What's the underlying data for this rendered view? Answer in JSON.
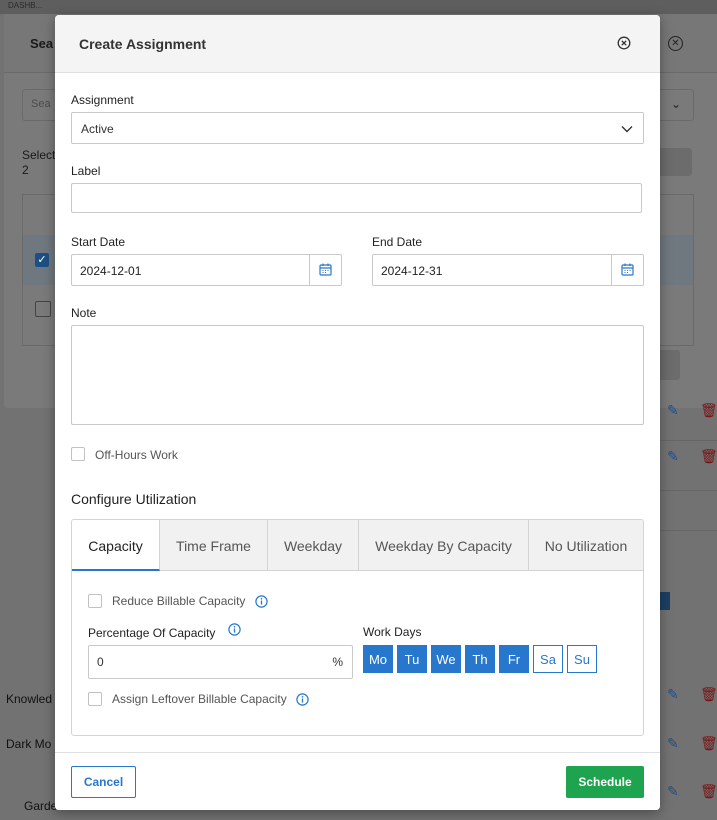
{
  "background": {
    "top_text": "DASHB...",
    "dialog_title": "Sea",
    "search_placeholder": "Sea",
    "selected_label": "Selecte",
    "selected_count": "2",
    "list_items": [
      "Knowled",
      "Dark Mo",
      "Garde"
    ]
  },
  "modal": {
    "title": "Create Assignment",
    "assignment": {
      "label": "Assignment",
      "value": "Active"
    },
    "label_field": {
      "label": "Label",
      "value": ""
    },
    "start_date": {
      "label": "Start Date",
      "value": "2024-12-01"
    },
    "end_date": {
      "label": "End Date",
      "value": "2024-12-31"
    },
    "note": {
      "label": "Note",
      "value": ""
    },
    "off_hours": {
      "label": "Off-Hours Work",
      "checked": false
    },
    "utilization": {
      "title": "Configure Utilization",
      "tabs": [
        "Capacity",
        "Time Frame",
        "Weekday",
        "Weekday By Capacity",
        "No Utilization"
      ],
      "active_tab": "Capacity",
      "reduce_billable": {
        "label": "Reduce Billable Capacity",
        "checked": false
      },
      "percentage": {
        "label": "Percentage Of Capacity",
        "value": "0",
        "unit": "%"
      },
      "work_days": {
        "label": "Work Days",
        "days": [
          {
            "label": "Mo",
            "selected": true
          },
          {
            "label": "Tu",
            "selected": true
          },
          {
            "label": "We",
            "selected": true
          },
          {
            "label": "Th",
            "selected": true
          },
          {
            "label": "Fr",
            "selected": true
          },
          {
            "label": "Sa",
            "selected": false
          },
          {
            "label": "Su",
            "selected": false
          }
        ]
      },
      "leftover": {
        "label": "Assign Leftover Billable Capacity",
        "checked": false
      }
    },
    "footer": {
      "cancel": "Cancel",
      "schedule": "Schedule"
    }
  },
  "colors": {
    "accent": "#2778cc",
    "success": "#1ea44f"
  }
}
